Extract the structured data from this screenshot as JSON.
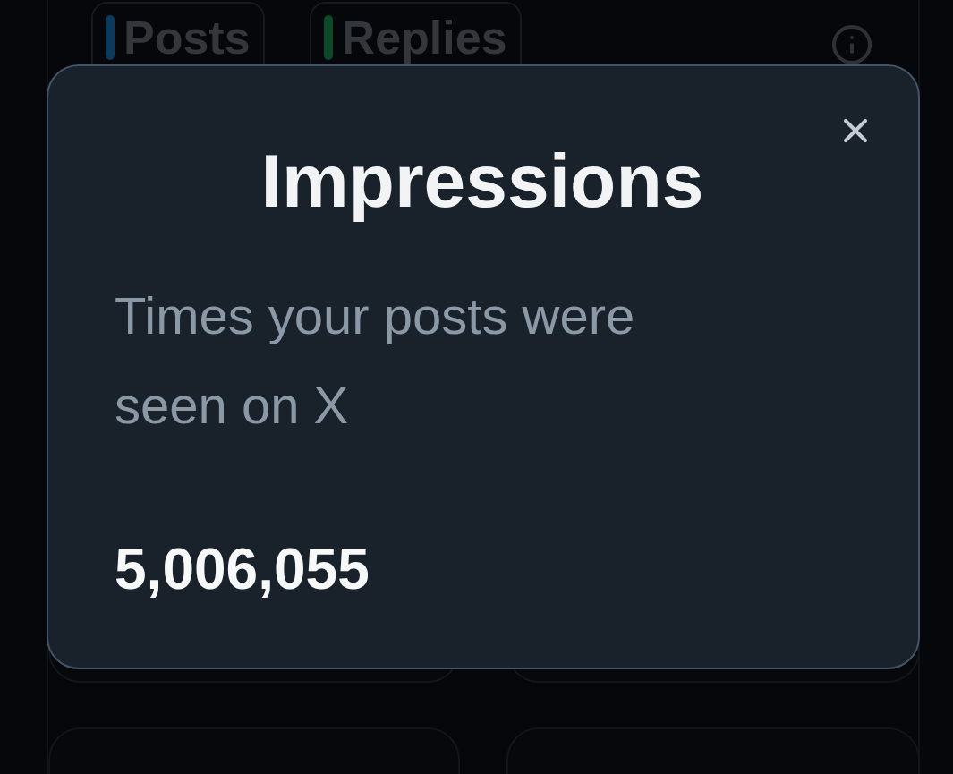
{
  "legend": [
    {
      "label": "Posts",
      "color": "#0b3a5c"
    },
    {
      "label": "Replies",
      "color": "#0a4a26"
    }
  ],
  "modal": {
    "title": "Impressions",
    "description": "Times your posts were seen on X",
    "value": "5,006,055"
  }
}
